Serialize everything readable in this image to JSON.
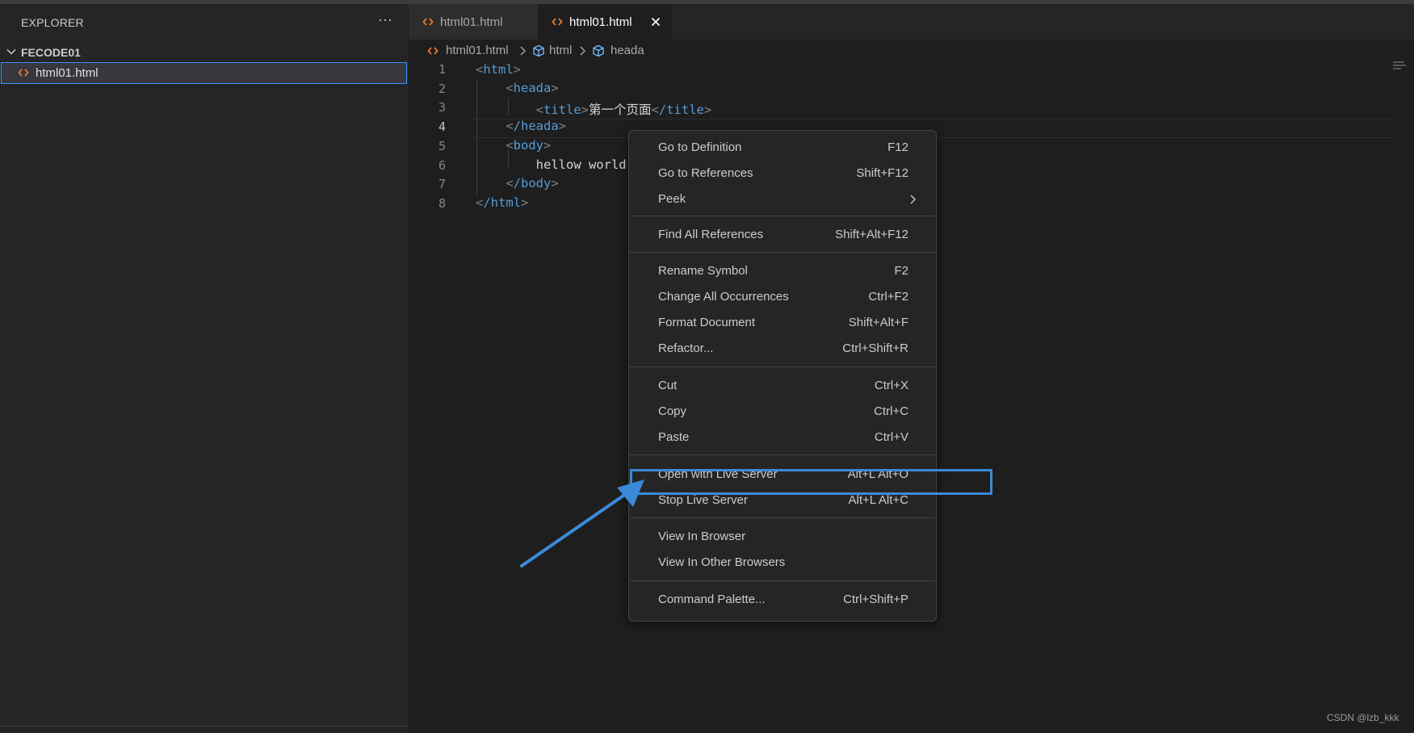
{
  "sidebar": {
    "title": "EXPLORER",
    "more_label": "···",
    "folder": "FECODE01",
    "files": [
      {
        "name": "html01.html"
      }
    ]
  },
  "tabs": [
    {
      "label": "html01.html",
      "active": false
    },
    {
      "label": "html01.html",
      "active": true
    }
  ],
  "breadcrumb": {
    "file": "html01.html",
    "items": [
      "html",
      "heada"
    ]
  },
  "editor": {
    "line_numbers": [
      "1",
      "2",
      "3",
      "4",
      "5",
      "6",
      "7",
      "8"
    ],
    "code": {
      "l1_tag": "html",
      "l2_tag": "heada",
      "l3_tag_open": "title",
      "l3_text": "第一个页面",
      "l3_tag_close": "/title",
      "l4_tag": "/heada",
      "l5_tag": "body",
      "l6_text": "hellow world",
      "l7_tag": "/body",
      "l8_tag": "/html"
    }
  },
  "context_menu": {
    "groups": [
      [
        {
          "label": "Go to Definition",
          "shortcut": "F12"
        },
        {
          "label": "Go to References",
          "shortcut": "Shift+F12"
        },
        {
          "label": "Peek",
          "shortcut": ""
        }
      ],
      [
        {
          "label": "Find All References",
          "shortcut": "Shift+Alt+F12"
        }
      ],
      [
        {
          "label": "Rename Symbol",
          "shortcut": "F2"
        },
        {
          "label": "Change All Occurrences",
          "shortcut": "Ctrl+F2"
        },
        {
          "label": "Format Document",
          "shortcut": "Shift+Alt+F"
        },
        {
          "label": "Refactor...",
          "shortcut": "Ctrl+Shift+R"
        }
      ],
      [
        {
          "label": "Cut",
          "shortcut": "Ctrl+X"
        },
        {
          "label": "Copy",
          "shortcut": "Ctrl+C"
        },
        {
          "label": "Paste",
          "shortcut": "Ctrl+V"
        }
      ],
      [
        {
          "label": "Open with Live Server",
          "shortcut": "Alt+L Alt+O"
        },
        {
          "label": "Stop Live Server",
          "shortcut": "Alt+L Alt+C"
        }
      ],
      [
        {
          "label": "View In Browser",
          "shortcut": ""
        },
        {
          "label": "View In Other Browsers",
          "shortcut": ""
        }
      ],
      [
        {
          "label": "Command Palette...",
          "shortcut": "Ctrl+Shift+P"
        }
      ]
    ]
  },
  "annotation": {
    "color": "#3b8ad9"
  },
  "watermark": "CSDN @lzb_kkk",
  "colors": {
    "accent": "#3794ff",
    "html_icon": "#e37933",
    "tag": "#569cd6",
    "bracket": "#808080"
  }
}
